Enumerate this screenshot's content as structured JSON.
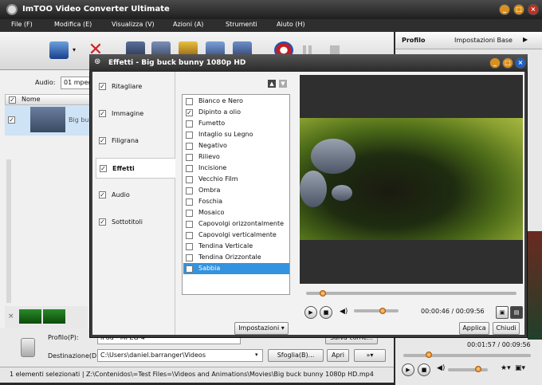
{
  "app": {
    "title": "ImTOO Video Converter Ultimate",
    "menu": [
      "File (F)",
      "Modifica (E)",
      "Visualizza (V)",
      "Azioni (A)",
      "Strumenti",
      "Aiuto (H)"
    ]
  },
  "left": {
    "audio_label": "Audio:",
    "audio_value": "01 mpeg",
    "list_header": "Nome",
    "file_name": "Big bu",
    "profile_label": "Profilo(P):",
    "profile_value": "iPod - MPEG-4",
    "save_as_label": "Salva come...",
    "dest_label": "Destinazione(D):",
    "dest_value": "C:\\Users\\daniel.barranger\\Videos",
    "browse_label": "Sfoglia(B)...",
    "open_label": "Apri"
  },
  "status": {
    "text": "1 elementi selezionati | Z:\\Contenidos\\=Test Files=\\Videos and Animations\\Movies\\Big buck bunny 1080p HD.mp4"
  },
  "right": {
    "profile_tab": "Profilo",
    "settings_tab": "Impostazioni Base",
    "time": "00:01:57 / 00:09:56",
    "seek_fraction": 0.2
  },
  "dialog": {
    "title": "Effetti - Big buck bunny 1080p HD",
    "tabs": [
      {
        "label": "Ritagliare",
        "checked": true,
        "active": false
      },
      {
        "label": "Immagine",
        "checked": true,
        "active": false
      },
      {
        "label": "Filigrana",
        "checked": true,
        "active": false
      },
      {
        "label": "Effetti",
        "checked": true,
        "active": true
      },
      {
        "label": "Audio",
        "checked": true,
        "active": false
      },
      {
        "label": "Sottotitoli",
        "checked": true,
        "active": false
      }
    ],
    "effects": [
      {
        "label": "Bianco e Nero",
        "checked": false
      },
      {
        "label": "Dipinto a olio",
        "checked": true
      },
      {
        "label": "Fumetto",
        "checked": false
      },
      {
        "label": "Intaglio su Legno",
        "checked": false
      },
      {
        "label": "Negativo",
        "checked": false
      },
      {
        "label": "Rilievo",
        "checked": false
      },
      {
        "label": "Incisione",
        "checked": false
      },
      {
        "label": "Vecchio Film",
        "checked": false
      },
      {
        "label": "Ombra",
        "checked": false
      },
      {
        "label": "Foschia",
        "checked": false
      },
      {
        "label": "Mosaico",
        "checked": false
      },
      {
        "label": "Capovolgi orizzontalmente",
        "checked": false
      },
      {
        "label": "Capovolgi verticalmente",
        "checked": false
      },
      {
        "label": "Tendina Verticale",
        "checked": false
      },
      {
        "label": "Tendina Orizzontale",
        "checked": false
      },
      {
        "label": "Sabbia",
        "checked": false,
        "selected": true
      }
    ],
    "settings_label": "Impostazioni",
    "time": "00:00:46 / 00:09:56",
    "seek_fraction": 0.08,
    "volume_fraction": 0.65,
    "apply_label": "Applica",
    "close_label": "Chiudi"
  },
  "colors": {
    "selection": "#3393df",
    "slider_knob": "#e07a10",
    "window_chrome": "#2a2a2a"
  }
}
